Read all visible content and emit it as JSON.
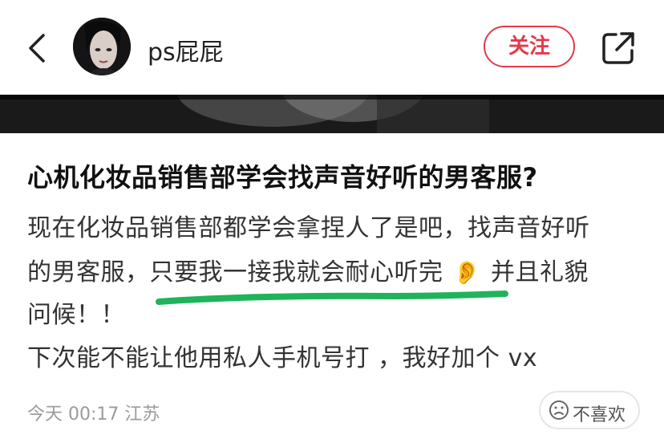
{
  "header": {
    "username": "ps屁屁",
    "follow_label": "关注"
  },
  "post": {
    "title": "心机化妆品销售部学会找声音好听的男客服?",
    "lines": [
      "现在化妆品销售部都学会拿捏人了是吧，找声音好听",
      "的男客服，只要我一接我就会耐心听完",
      "并且礼貌",
      "问候！！",
      "下次能不能让他用私人手机号打 ，我好加个 vx"
    ],
    "ear_emoji": "👂",
    "underline_color": "#1fb45a"
  },
  "meta": {
    "date": "今天 00:17",
    "location": "江苏"
  },
  "actions": {
    "dislike_label": "不喜欢"
  },
  "colors": {
    "accent": "#e4394a",
    "meta_text": "#9a9a9a"
  },
  "icons": {
    "back": "chevron-left-icon",
    "share": "share-icon",
    "dislike": "sad-face-icon"
  }
}
